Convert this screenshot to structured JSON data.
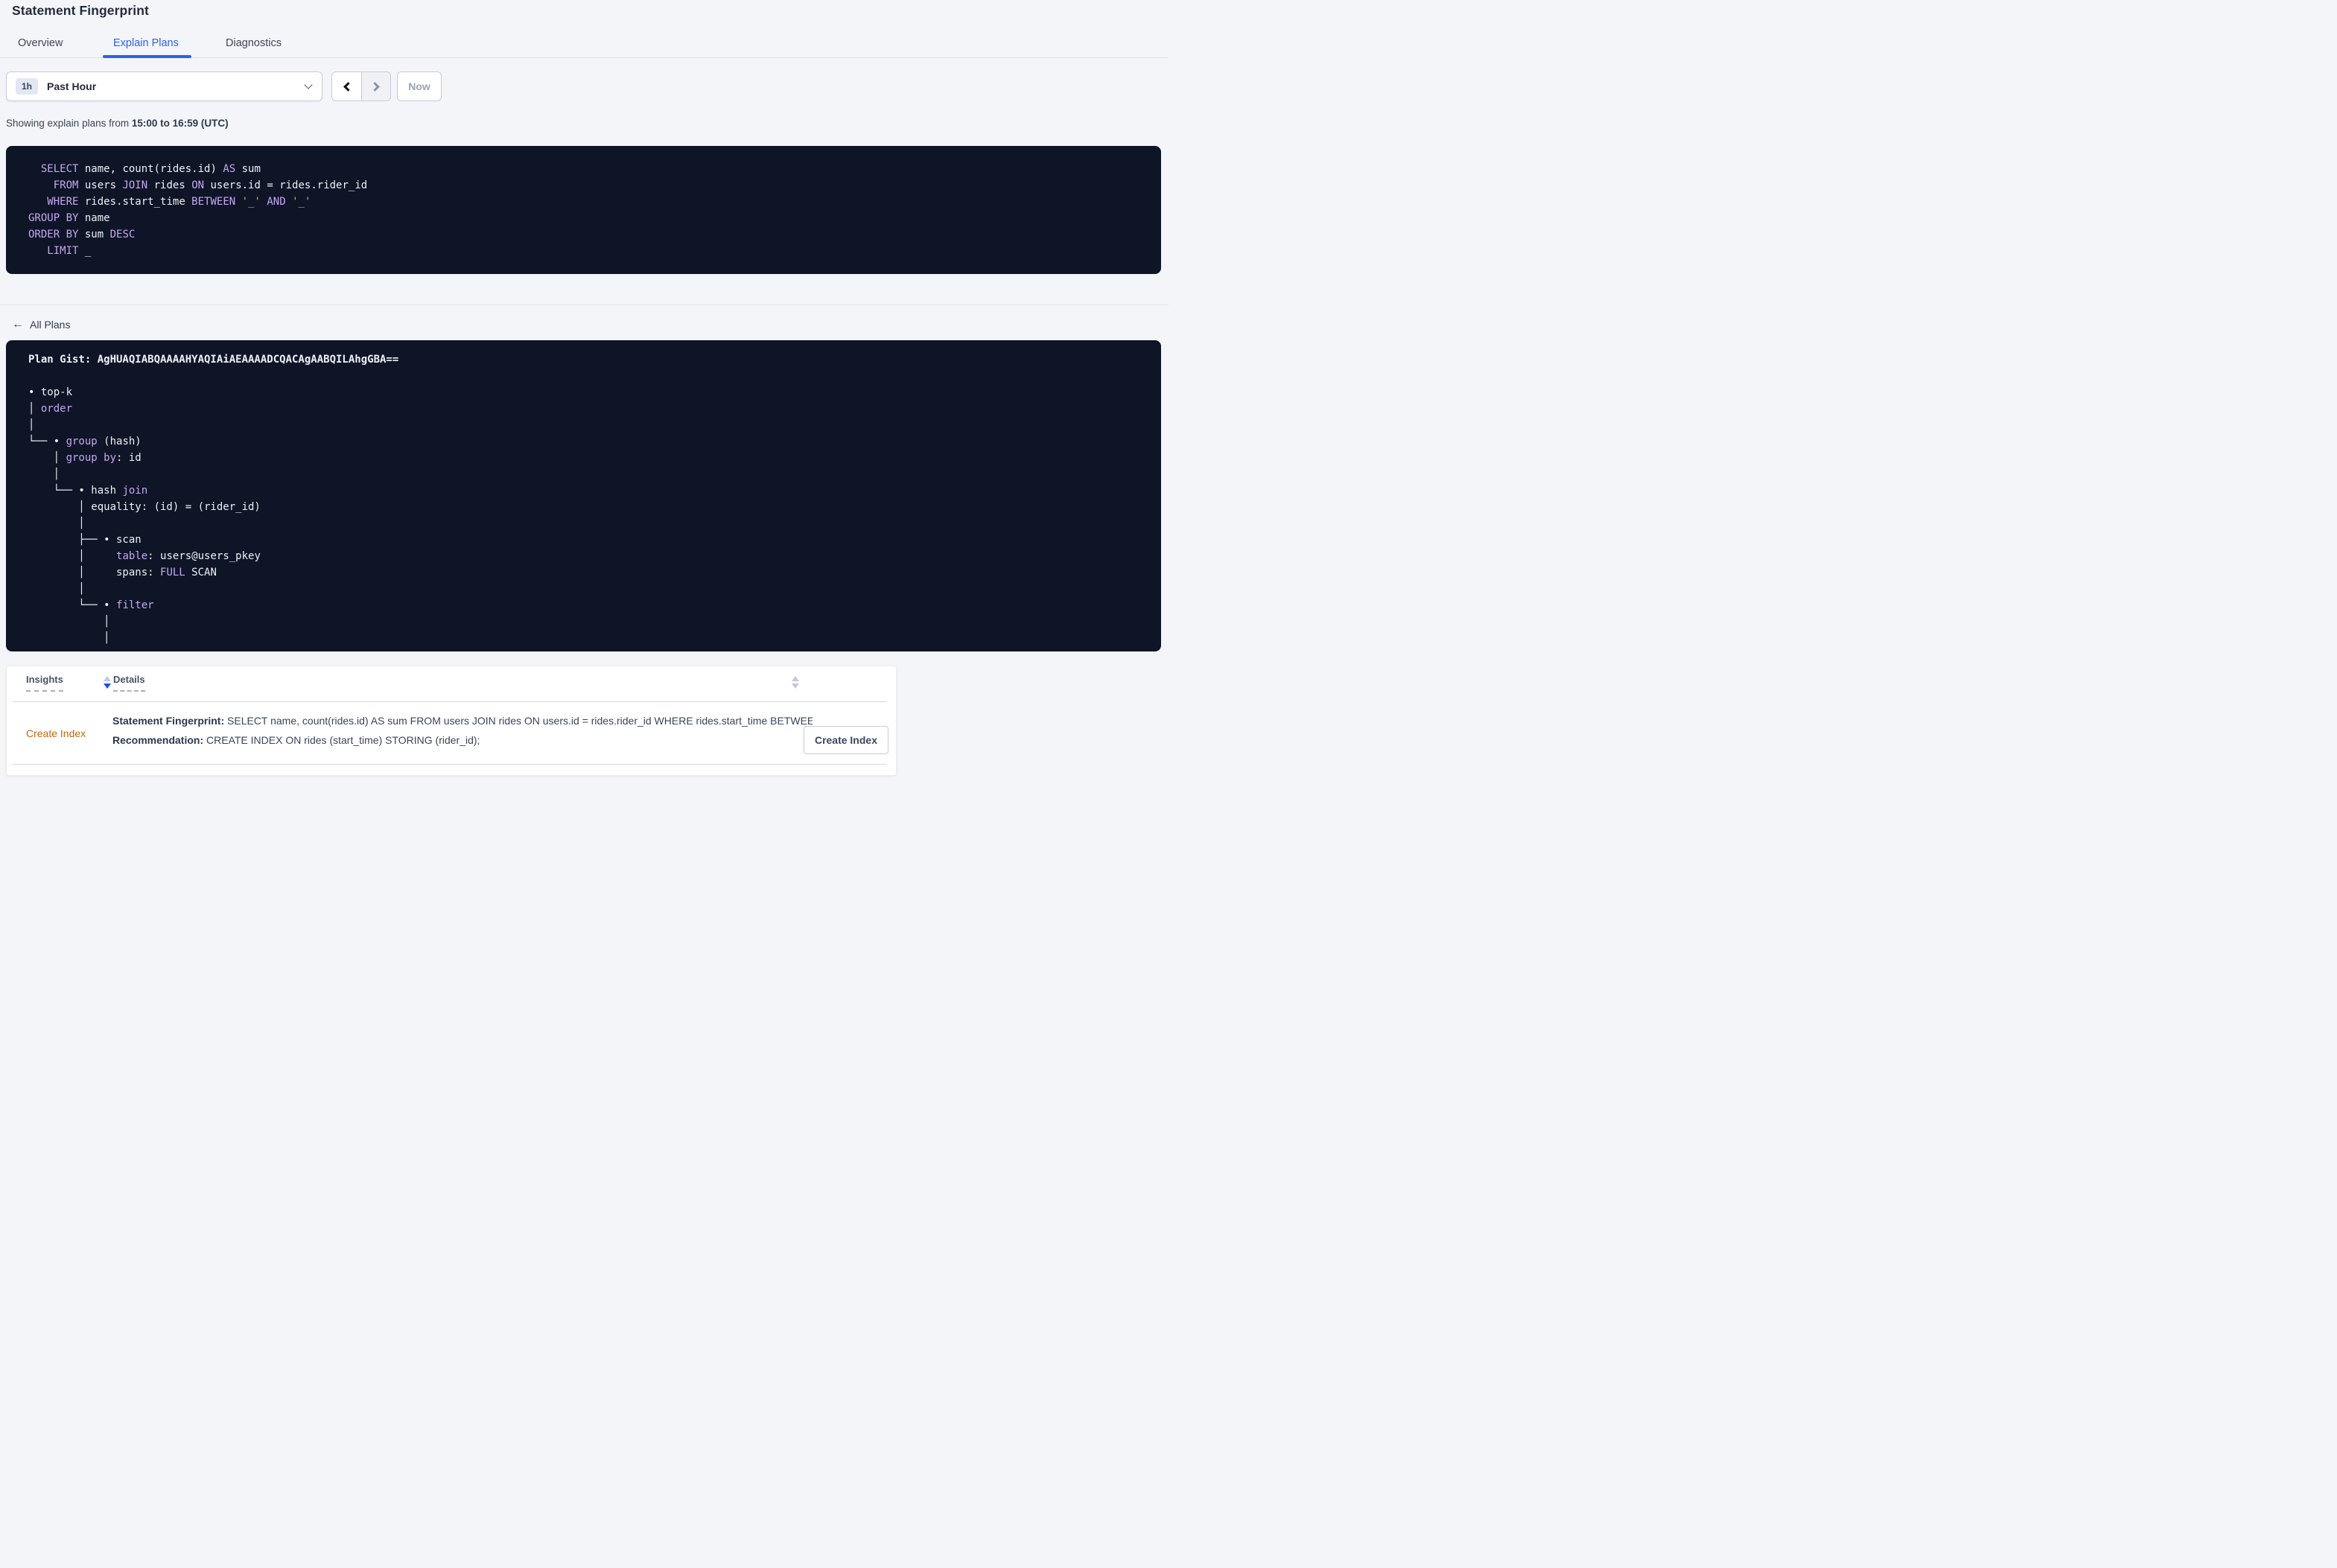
{
  "page": {
    "title": "Statement Fingerprint"
  },
  "tabs": [
    {
      "label": "Overview",
      "active": false
    },
    {
      "label": "Explain Plans",
      "active": true
    },
    {
      "label": "Diagnostics",
      "active": false
    }
  ],
  "time_controls": {
    "interval_badge": "1h",
    "interval_label": "Past Hour",
    "now_label": "Now"
  },
  "caption": {
    "prefix": "Showing explain plans from ",
    "range": "15:00 to 16:59 (UTC)"
  },
  "sql": {
    "lines": [
      [
        {
          "t": "  ",
          "c": "id"
        },
        {
          "t": "SELECT",
          "c": "kw"
        },
        {
          "t": " name, count(rides.id) ",
          "c": "id"
        },
        {
          "t": "AS",
          "c": "kw"
        },
        {
          "t": " sum",
          "c": "id"
        }
      ],
      [
        {
          "t": "    ",
          "c": "id"
        },
        {
          "t": "FROM",
          "c": "kw"
        },
        {
          "t": " users ",
          "c": "id"
        },
        {
          "t": "JOIN",
          "c": "kw"
        },
        {
          "t": " rides ",
          "c": "id"
        },
        {
          "t": "ON",
          "c": "kw"
        },
        {
          "t": " users.id = rides.rider_id",
          "c": "id"
        }
      ],
      [
        {
          "t": "   ",
          "c": "id"
        },
        {
          "t": "WHERE",
          "c": "kw"
        },
        {
          "t": " rides.start_time ",
          "c": "id"
        },
        {
          "t": "BETWEEN",
          "c": "kw"
        },
        {
          "t": " ",
          "c": "id"
        },
        {
          "t": "'_'",
          "c": "lit"
        },
        {
          "t": " ",
          "c": "id"
        },
        {
          "t": "AND",
          "c": "kw"
        },
        {
          "t": " ",
          "c": "id"
        },
        {
          "t": "'_'",
          "c": "lit"
        }
      ],
      [
        {
          "t": "GROUP BY",
          "c": "kw"
        },
        {
          "t": " name",
          "c": "id"
        }
      ],
      [
        {
          "t": "ORDER BY",
          "c": "kw"
        },
        {
          "t": " sum ",
          "c": "id"
        },
        {
          "t": "DESC",
          "c": "kw"
        }
      ],
      [
        {
          "t": "   ",
          "c": "id"
        },
        {
          "t": "LIMIT",
          "c": "kw"
        },
        {
          "t": " _",
          "c": "id"
        }
      ]
    ]
  },
  "all_plans": {
    "label": "All Plans",
    "arrow": "←"
  },
  "plan": {
    "gist_line": "Plan Gist: AgHUAQIABQAAAAHYAQIAiAEAAAADCQACAgAABQILAhgGBA==",
    "tree_lines": [
      [
        {
          "t": "• top-k",
          "c": "id"
        }
      ],
      [
        {
          "t": "│ ",
          "c": "id"
        },
        {
          "t": "order",
          "c": "kw"
        }
      ],
      [
        {
          "t": "│",
          "c": "id"
        }
      ],
      [
        {
          "t": "└── • ",
          "c": "id"
        },
        {
          "t": "group",
          "c": "kw"
        },
        {
          "t": " (hash)",
          "c": "id"
        }
      ],
      [
        {
          "t": "    │ ",
          "c": "id"
        },
        {
          "t": "group by",
          "c": "kw"
        },
        {
          "t": ": id",
          "c": "id"
        }
      ],
      [
        {
          "t": "    │",
          "c": "id"
        }
      ],
      [
        {
          "t": "    └── • hash ",
          "c": "id"
        },
        {
          "t": "join",
          "c": "kw"
        }
      ],
      [
        {
          "t": "        │ equality: (id) = (rider_id)",
          "c": "id"
        }
      ],
      [
        {
          "t": "        │",
          "c": "id"
        }
      ],
      [
        {
          "t": "        ├── • scan",
          "c": "id"
        }
      ],
      [
        {
          "t": "        │     ",
          "c": "id"
        },
        {
          "t": "table",
          "c": "kw"
        },
        {
          "t": ": users@users_pkey",
          "c": "id"
        }
      ],
      [
        {
          "t": "        │     spans: ",
          "c": "id"
        },
        {
          "t": "FULL",
          "c": "kw"
        },
        {
          "t": " SCAN",
          "c": "id"
        }
      ],
      [
        {
          "t": "        │",
          "c": "id"
        }
      ],
      [
        {
          "t": "        └── • ",
          "c": "id"
        },
        {
          "t": "filter",
          "c": "kw"
        }
      ],
      [
        {
          "t": "            │",
          "c": "id"
        }
      ],
      [
        {
          "t": "            │",
          "c": "id"
        }
      ]
    ]
  },
  "insights_table": {
    "columns": {
      "insights": "Insights",
      "details": "Details"
    },
    "row": {
      "insight": "Create Index",
      "detail_1_label": "Statement Fingerprint:",
      "detail_1_text": " SELECT name, count(rides.id) AS sum FROM users JOIN rides ON users.id = rides.rider_id WHERE rides.start_time BETWEEN '_...",
      "detail_2_label": "Recommendation:",
      "detail_2_text": " CREATE INDEX ON rides (start_time) STORING (rider_id);",
      "action": "Create Index"
    }
  },
  "colors": {
    "accent_blue": "#2a63e8",
    "sort_active_blue": "#1b4dff",
    "insight_orange": "#c1690e",
    "code_background": "#0e1526",
    "code_keyword": "#c7a6f3",
    "code_text": "#eef0f7",
    "code_literal": "#f0a23c",
    "page_background": "#f4f5f9"
  }
}
